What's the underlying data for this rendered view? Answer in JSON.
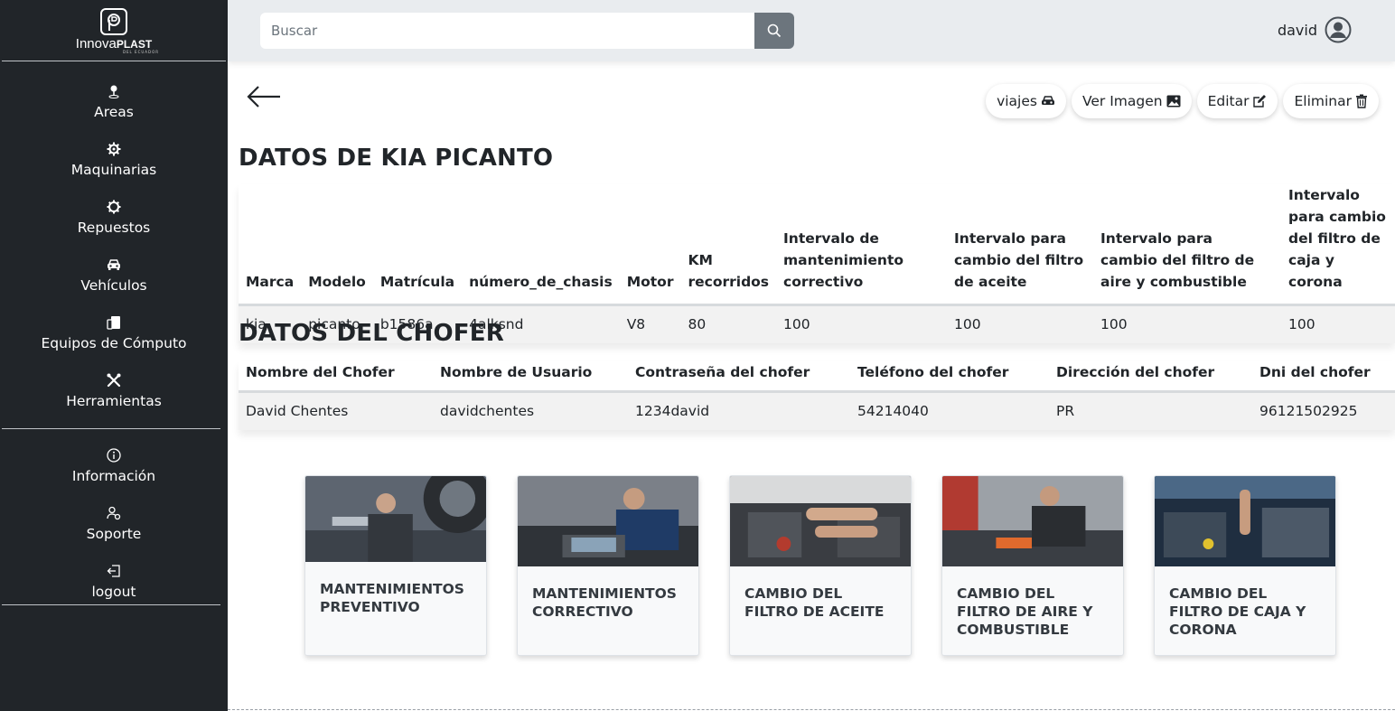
{
  "brand": {
    "logo_text": "Innova",
    "logo_bold": "PLAST",
    "logo_sub": "DEL ECUADOR"
  },
  "sidebar": {
    "items": [
      {
        "label": "Areas",
        "icon": "pin-icon"
      },
      {
        "label": "Maquinarias",
        "icon": "gear-icon"
      },
      {
        "label": "Repuestos",
        "icon": "gear-icon"
      },
      {
        "label": "Vehículos",
        "icon": "car-icon"
      },
      {
        "label": "Equipos de Cómputo",
        "icon": "devices-icon"
      },
      {
        "label": "Herramientas",
        "icon": "tools-icon"
      }
    ],
    "items2": [
      {
        "label": "Información",
        "icon": "info-icon"
      },
      {
        "label": "Soporte",
        "icon": "support-icon"
      },
      {
        "label": "logout",
        "icon": "logout-icon"
      }
    ]
  },
  "search": {
    "placeholder": "Buscar"
  },
  "user": {
    "name": "david"
  },
  "actions": {
    "viajes": "viajes",
    "ver_imagen": "Ver Imagen",
    "editar": "Editar",
    "eliminar": "Eliminar"
  },
  "vehicle": {
    "title": "DATOS DE KIA PICANTO",
    "headers": [
      "Marca",
      "Modelo",
      "Matrícula",
      "número_de_chasis",
      "Motor",
      "KM recorridos",
      "Intervalo de mantenimiento correctivo",
      "Intervalo para cambio del filtro de aceite",
      "Intervalo para cambio del filtro de aire y combustible",
      "Intervalo para cambio del filtro de caja y corona"
    ],
    "row": [
      "kia",
      "picanto",
      "b1586a",
      "4alksnd",
      "V8",
      "80",
      "100",
      "100",
      "100",
      "100"
    ]
  },
  "driver": {
    "title": "DATOS DEL CHOFER",
    "headers": [
      "Nombre del Chofer",
      "Nombre de Usuario",
      "Contraseña del chofer",
      "Teléfono del chofer",
      "Dirección del chofer",
      "Dni del chofer"
    ],
    "row": [
      "David Chentes",
      "davidchentes",
      "1234david",
      "54214040",
      "PR",
      "96121502925"
    ]
  },
  "cards": [
    {
      "title": "MANTENIMIENTOS PREVENTIVO"
    },
    {
      "title": "MANTENIMIENTOS CORRECTIVO"
    },
    {
      "title": "CAMBIO DEL FILTRO DE ACEITE"
    },
    {
      "title": "CAMBIO DEL FILTRO DE AIRE Y COMBUSTIBLE"
    },
    {
      "title": "CAMBIO DEL FILTRO DE CAJA Y CORONA"
    }
  ],
  "colors": {
    "sidebar_bg": "#212529",
    "topbar_bg": "#e9ecef",
    "search_btn": "#6c757d"
  }
}
